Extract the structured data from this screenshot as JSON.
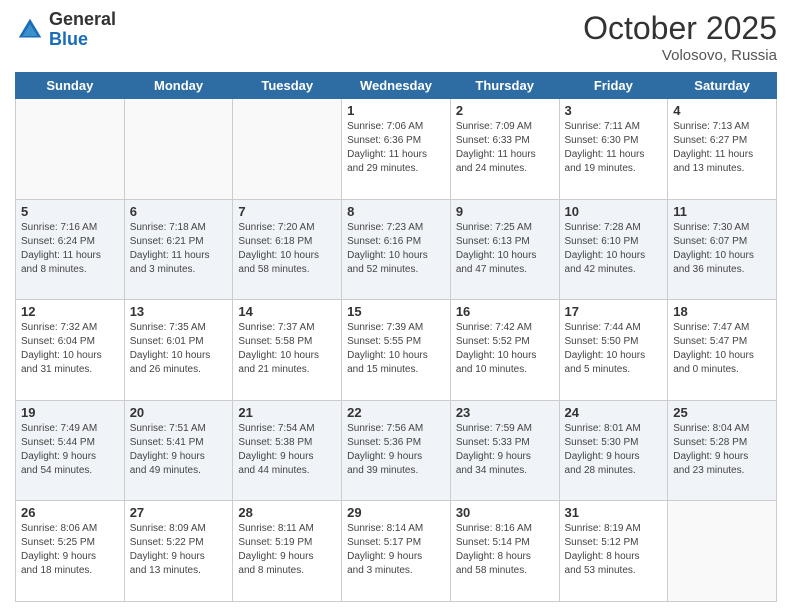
{
  "logo": {
    "general": "General",
    "blue": "Blue"
  },
  "header": {
    "month": "October 2025",
    "location": "Volosovo, Russia"
  },
  "weekdays": [
    "Sunday",
    "Monday",
    "Tuesday",
    "Wednesday",
    "Thursday",
    "Friday",
    "Saturday"
  ],
  "weeks": [
    [
      {
        "day": "",
        "info": ""
      },
      {
        "day": "",
        "info": ""
      },
      {
        "day": "",
        "info": ""
      },
      {
        "day": "1",
        "info": "Sunrise: 7:06 AM\nSunset: 6:36 PM\nDaylight: 11 hours\nand 29 minutes."
      },
      {
        "day": "2",
        "info": "Sunrise: 7:09 AM\nSunset: 6:33 PM\nDaylight: 11 hours\nand 24 minutes."
      },
      {
        "day": "3",
        "info": "Sunrise: 7:11 AM\nSunset: 6:30 PM\nDaylight: 11 hours\nand 19 minutes."
      },
      {
        "day": "4",
        "info": "Sunrise: 7:13 AM\nSunset: 6:27 PM\nDaylight: 11 hours\nand 13 minutes."
      }
    ],
    [
      {
        "day": "5",
        "info": "Sunrise: 7:16 AM\nSunset: 6:24 PM\nDaylight: 11 hours\nand 8 minutes."
      },
      {
        "day": "6",
        "info": "Sunrise: 7:18 AM\nSunset: 6:21 PM\nDaylight: 11 hours\nand 3 minutes."
      },
      {
        "day": "7",
        "info": "Sunrise: 7:20 AM\nSunset: 6:18 PM\nDaylight: 10 hours\nand 58 minutes."
      },
      {
        "day": "8",
        "info": "Sunrise: 7:23 AM\nSunset: 6:16 PM\nDaylight: 10 hours\nand 52 minutes."
      },
      {
        "day": "9",
        "info": "Sunrise: 7:25 AM\nSunset: 6:13 PM\nDaylight: 10 hours\nand 47 minutes."
      },
      {
        "day": "10",
        "info": "Sunrise: 7:28 AM\nSunset: 6:10 PM\nDaylight: 10 hours\nand 42 minutes."
      },
      {
        "day": "11",
        "info": "Sunrise: 7:30 AM\nSunset: 6:07 PM\nDaylight: 10 hours\nand 36 minutes."
      }
    ],
    [
      {
        "day": "12",
        "info": "Sunrise: 7:32 AM\nSunset: 6:04 PM\nDaylight: 10 hours\nand 31 minutes."
      },
      {
        "day": "13",
        "info": "Sunrise: 7:35 AM\nSunset: 6:01 PM\nDaylight: 10 hours\nand 26 minutes."
      },
      {
        "day": "14",
        "info": "Sunrise: 7:37 AM\nSunset: 5:58 PM\nDaylight: 10 hours\nand 21 minutes."
      },
      {
        "day": "15",
        "info": "Sunrise: 7:39 AM\nSunset: 5:55 PM\nDaylight: 10 hours\nand 15 minutes."
      },
      {
        "day": "16",
        "info": "Sunrise: 7:42 AM\nSunset: 5:52 PM\nDaylight: 10 hours\nand 10 minutes."
      },
      {
        "day": "17",
        "info": "Sunrise: 7:44 AM\nSunset: 5:50 PM\nDaylight: 10 hours\nand 5 minutes."
      },
      {
        "day": "18",
        "info": "Sunrise: 7:47 AM\nSunset: 5:47 PM\nDaylight: 10 hours\nand 0 minutes."
      }
    ],
    [
      {
        "day": "19",
        "info": "Sunrise: 7:49 AM\nSunset: 5:44 PM\nDaylight: 9 hours\nand 54 minutes."
      },
      {
        "day": "20",
        "info": "Sunrise: 7:51 AM\nSunset: 5:41 PM\nDaylight: 9 hours\nand 49 minutes."
      },
      {
        "day": "21",
        "info": "Sunrise: 7:54 AM\nSunset: 5:38 PM\nDaylight: 9 hours\nand 44 minutes."
      },
      {
        "day": "22",
        "info": "Sunrise: 7:56 AM\nSunset: 5:36 PM\nDaylight: 9 hours\nand 39 minutes."
      },
      {
        "day": "23",
        "info": "Sunrise: 7:59 AM\nSunset: 5:33 PM\nDaylight: 9 hours\nand 34 minutes."
      },
      {
        "day": "24",
        "info": "Sunrise: 8:01 AM\nSunset: 5:30 PM\nDaylight: 9 hours\nand 28 minutes."
      },
      {
        "day": "25",
        "info": "Sunrise: 8:04 AM\nSunset: 5:28 PM\nDaylight: 9 hours\nand 23 minutes."
      }
    ],
    [
      {
        "day": "26",
        "info": "Sunrise: 8:06 AM\nSunset: 5:25 PM\nDaylight: 9 hours\nand 18 minutes."
      },
      {
        "day": "27",
        "info": "Sunrise: 8:09 AM\nSunset: 5:22 PM\nDaylight: 9 hours\nand 13 minutes."
      },
      {
        "day": "28",
        "info": "Sunrise: 8:11 AM\nSunset: 5:19 PM\nDaylight: 9 hours\nand 8 minutes."
      },
      {
        "day": "29",
        "info": "Sunrise: 8:14 AM\nSunset: 5:17 PM\nDaylight: 9 hours\nand 3 minutes."
      },
      {
        "day": "30",
        "info": "Sunrise: 8:16 AM\nSunset: 5:14 PM\nDaylight: 8 hours\nand 58 minutes."
      },
      {
        "day": "31",
        "info": "Sunrise: 8:19 AM\nSunset: 5:12 PM\nDaylight: 8 hours\nand 53 minutes."
      },
      {
        "day": "",
        "info": ""
      }
    ]
  ]
}
